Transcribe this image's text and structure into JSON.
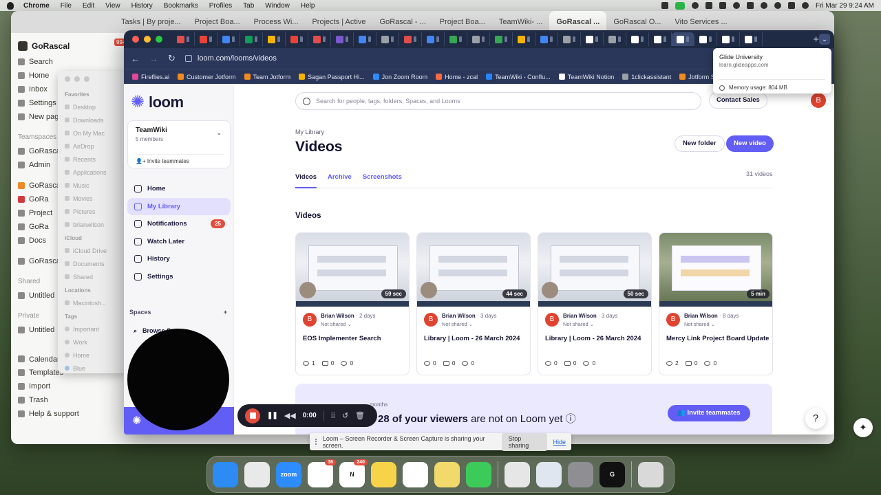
{
  "menubar": {
    "app": "Chrome",
    "items": [
      "File",
      "Edit",
      "View",
      "History",
      "Bookmarks",
      "Profiles",
      "Tab",
      "Window",
      "Help"
    ],
    "datetime": "Fri Mar 29  9:24 AM"
  },
  "back_window": {
    "tabs": [
      "Tasks | By proje...",
      "Project Boa...",
      "Process Wi...",
      "Projects | Active",
      "GoRascal - ...",
      "Project Boa...",
      "TeamWiki- ...",
      "GoRascal ...",
      "GoRascal O...",
      "Vito Services ..."
    ],
    "workspace": "GoRascal",
    "sidebar": {
      "top": [
        "Search",
        "Home",
        "Inbox",
        "Settings",
        "New page"
      ],
      "teamspaces_head": "Teamspaces",
      "teamspaces": [
        "GoRascal",
        "Admin",
        "GoRascal",
        "GoRa",
        "Project",
        "GoRa",
        "Docs",
        "GoRascal"
      ],
      "shared_head": "Shared",
      "shared": [
        "Untitled"
      ],
      "private_head": "Private",
      "private": [
        "Untitled"
      ],
      "bottom": [
        "Calendar ↗",
        "Templates",
        "Import",
        "Trash",
        "Help & support"
      ]
    },
    "notif_badge": "99+"
  },
  "finder": {
    "favorites_head": "Favorites",
    "favorites": [
      "Desktop",
      "Downloads",
      "On My Mac",
      "AirDrop",
      "Recents",
      "Applications",
      "Music",
      "Movies",
      "Pictures",
      "brianwilson"
    ],
    "icloud_head": "iCloud",
    "icloud": [
      "iCloud Drive",
      "Documents",
      "Shared"
    ],
    "locations_head": "Locations",
    "locations": [
      "Macintosh..."
    ],
    "tags_head": "Tags",
    "tags": [
      "Important",
      "Work",
      "Home",
      "Blue"
    ]
  },
  "chrome": {
    "url": "loom.com/looms/videos",
    "bookmarks": [
      "Fireflies.ai",
      "Customer Jotform",
      "Team Jotform",
      "Sagan Passport Hi...",
      "Jon Zoom Room",
      "Home - zcal",
      "TeamWiki - Conflu...",
      "TeamWiki Notion",
      "1clickassistant",
      "Jotform Submissi..."
    ],
    "tab_colors": [
      "#e24c4c",
      "#ea4335",
      "#4285f4",
      "#0f9d58",
      "#f4b400",
      "#ea4335",
      "#e24c4c",
      "#7b57d0",
      "#4285f4",
      "#9aa0a6",
      "#e24c4c",
      "#4285f4",
      "#34a853",
      "#9aa0a6",
      "#34a853",
      "#f4b400",
      "#4285f4",
      "#9aa0a6",
      "#ffffff",
      "#9aa0a6",
      "#ffffff",
      "#ffffff",
      "#ffffff",
      "#ffffff",
      "#ffffff",
      "#ffffff"
    ]
  },
  "tooltip": {
    "title": "Glide University",
    "url": "learn.glideapps.com",
    "memory": "Memory usage: 804 MB"
  },
  "loom": {
    "logo": "loom",
    "workspace_name": "TeamWiki",
    "workspace_members": "5 members",
    "invite": "Invite teammates",
    "nav": [
      {
        "label": "Home",
        "active": false
      },
      {
        "label": "My Library",
        "active": true
      },
      {
        "label": "Notifications",
        "active": false,
        "badge": "25"
      },
      {
        "label": "Watch Later",
        "active": false
      },
      {
        "label": "History",
        "active": false
      },
      {
        "label": "Settings",
        "active": false
      }
    ],
    "spaces_label": "Spaces",
    "spaces_add": "+",
    "browse": "Browse Spaces",
    "search_placeholder": "Search for people, tags, folders, Spaces, and Looms",
    "contact_sales": "Contact Sales",
    "avatar_letter": "B",
    "breadcrumb": "My Library",
    "page_title": "Videos",
    "new_folder": "New folder",
    "new_video": "New video",
    "tabs": [
      "Videos",
      "Archive",
      "Screenshots"
    ],
    "video_count": "31 videos",
    "section_title": "Videos",
    "videos": [
      {
        "duration": "59 sec",
        "author": "Brian Wilson",
        "age": "· 2 days",
        "shared": "Not shared",
        "title": "EOS Implementer Search",
        "views": "1",
        "comments": "0",
        "reactions": "0"
      },
      {
        "duration": "44 sec",
        "author": "Brian Wilson",
        "age": "· 3 days",
        "shared": "Not shared",
        "title": "Library | Loom - 26 March 2024",
        "views": "0",
        "comments": "0",
        "reactions": "0"
      },
      {
        "duration": "50 sec",
        "author": "Brian Wilson",
        "age": "· 3 days",
        "shared": "Not shared",
        "title": "Library | Loom - 26 March 2024",
        "views": "0",
        "comments": "0",
        "reactions": "0"
      },
      {
        "duration": "5 min",
        "author": "Brian Wilson",
        "age": "· 8 days",
        "shared": "Not shared",
        "title": "Mercy Link Project Board Update",
        "views": "2",
        "comments": "0",
        "reactions": "0"
      }
    ],
    "banner_pre": "months",
    "banner_strong": "28 of your viewers",
    "banner_rest": " are not on Loom yet ⓘ",
    "banner_button": "Invite teammates",
    "help": "?"
  },
  "recorder": {
    "time": "0:00"
  },
  "sharebar": {
    "text": "Loom – Screen Recorder & Screen Capture is sharing your screen.",
    "stop": "Stop sharing",
    "hide": "Hide"
  },
  "dock": {
    "apps": [
      {
        "name": "finder",
        "color": "#2c8cf4",
        "label": ""
      },
      {
        "name": "chrome",
        "color": "#e9e9e9",
        "label": ""
      },
      {
        "name": "zoom",
        "color": "#2d8cff",
        "label": "zoom"
      },
      {
        "name": "slack",
        "color": "#ffffff",
        "label": "",
        "badge": "36"
      },
      {
        "name": "notion",
        "color": "#ffffff",
        "label": "N",
        "badge": "240"
      },
      {
        "name": "notes",
        "color": "#f7d34a",
        "label": ""
      },
      {
        "name": "freeform",
        "color": "#ffffff",
        "label": ""
      },
      {
        "name": "stickies",
        "color": "#f2d96b",
        "label": ""
      },
      {
        "name": "messages",
        "color": "#3ccb5a",
        "label": ""
      },
      {
        "name": "script-editor",
        "color": "#e6e6e6",
        "label": ""
      },
      {
        "name": "preview",
        "color": "#dfe6ef",
        "label": ""
      },
      {
        "name": "system-settings",
        "color": "#8e8e93",
        "label": ""
      },
      {
        "name": "logi",
        "color": "#111111",
        "label": "G"
      },
      {
        "name": "trash",
        "color": "#d9d9d9",
        "label": ""
      }
    ]
  }
}
